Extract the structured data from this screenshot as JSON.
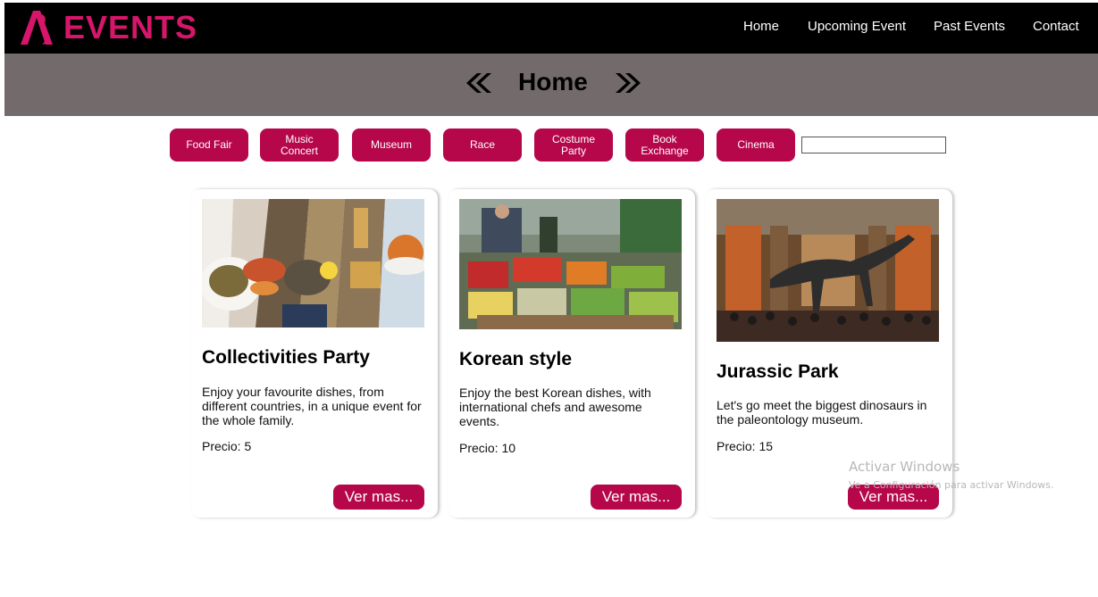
{
  "navbar": {
    "logo_text": "EVENTS",
    "links": [
      {
        "label": "Home"
      },
      {
        "label": "Upcoming Event"
      },
      {
        "label": "Past Events"
      },
      {
        "label": "Contact"
      }
    ]
  },
  "banner": {
    "title": "Home"
  },
  "categories": [
    {
      "label": "Food Fair"
    },
    {
      "label": "Music Concert"
    },
    {
      "label": "Museum"
    },
    {
      "label": "Race"
    },
    {
      "label": "Costume Party"
    },
    {
      "label": "Book Exchange"
    },
    {
      "label": "Cinema"
    }
  ],
  "search": {
    "value": ""
  },
  "cards": [
    {
      "title": "Collectivities Party",
      "description": "Enjoy your favourite dishes, from different countries, in a unique event for the whole family.",
      "price_label": "Precio:",
      "price": "5",
      "button_label": "Ver mas..."
    },
    {
      "title": "Korean style",
      "description": "Enjoy the best Korean dishes, with international chefs and awesome events.",
      "price_label": "Precio:",
      "price": "10",
      "button_label": "Ver mas..."
    },
    {
      "title": "Jurassic Park",
      "description": "Let's go meet the biggest dinosaurs in the paleontology museum.",
      "price_label": "Precio:",
      "price": "15",
      "button_label": "Ver mas..."
    }
  ],
  "watermark": {
    "title": "Activar Windows",
    "subtitle": "Ve a Configuración para activar Windows."
  },
  "colors": {
    "accent": "#b5074a",
    "logo": "#d6166a",
    "navbar": "#000000",
    "banner": "#736b6b"
  }
}
